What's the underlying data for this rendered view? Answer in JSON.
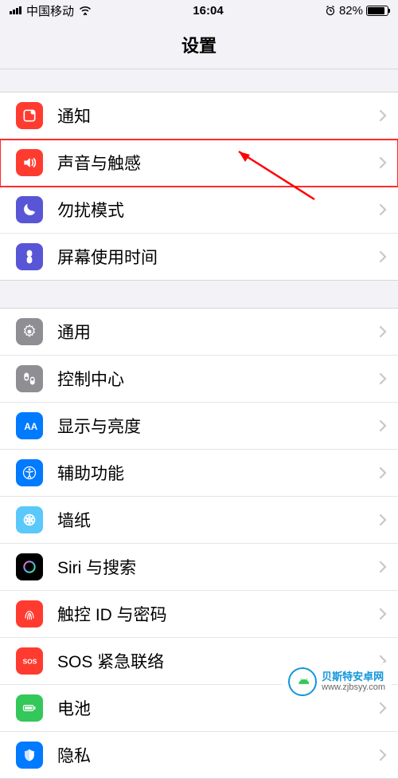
{
  "status": {
    "carrier": "中国移动",
    "time": "16:04",
    "battery": "82%"
  },
  "header": {
    "title": "设置"
  },
  "sections": [
    {
      "items": [
        {
          "label": "通知",
          "icon": "notifications-icon",
          "color": "#ff3b30"
        },
        {
          "label": "声音与触感",
          "icon": "sounds-icon",
          "color": "#ff3b30",
          "highlighted": true
        },
        {
          "label": "勿扰模式",
          "icon": "dnd-icon",
          "color": "#5856d6"
        },
        {
          "label": "屏幕使用时间",
          "icon": "screentime-icon",
          "color": "#5856d6"
        }
      ]
    },
    {
      "items": [
        {
          "label": "通用",
          "icon": "general-icon",
          "color": "#8e8e93"
        },
        {
          "label": "控制中心",
          "icon": "control-center-icon",
          "color": "#8e8e93"
        },
        {
          "label": "显示与亮度",
          "icon": "display-icon",
          "color": "#007aff"
        },
        {
          "label": "辅助功能",
          "icon": "accessibility-icon",
          "color": "#007aff"
        },
        {
          "label": "墙纸",
          "icon": "wallpaper-icon",
          "color": "#5ac8fa"
        },
        {
          "label": "Siri 与搜索",
          "icon": "siri-icon",
          "color": "#000000"
        },
        {
          "label": "触控 ID 与密码",
          "icon": "touchid-icon",
          "color": "#ff3b30"
        },
        {
          "label": "SOS 紧急联络",
          "icon": "sos-icon",
          "color": "#ff3b30"
        },
        {
          "label": "电池",
          "icon": "battery-icon",
          "color": "#34c759"
        },
        {
          "label": "隐私",
          "icon": "privacy-icon",
          "color": "#007aff"
        }
      ]
    }
  ],
  "watermark": {
    "brand": "贝斯特安卓网",
    "url": "www.zjbsyy.com"
  }
}
